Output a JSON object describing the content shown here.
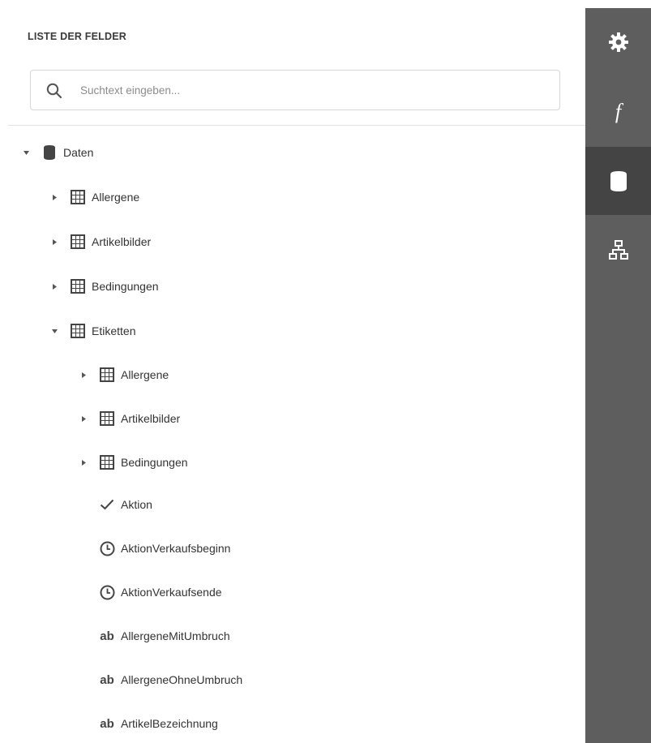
{
  "panel": {
    "title": "LISTE DER FELDER",
    "search": {
      "placeholder": "Suchtext eingeben...",
      "value": ""
    }
  },
  "tree": {
    "root": {
      "label": "Daten",
      "icon": "database-icon",
      "state": "expanded"
    },
    "items": [
      {
        "label": "Allergene",
        "icon": "table-icon",
        "state": "collapsed"
      },
      {
        "label": "Artikelbilder",
        "icon": "table-icon",
        "state": "collapsed"
      },
      {
        "label": "Bedingungen",
        "icon": "table-icon",
        "state": "collapsed"
      },
      {
        "label": "Etiketten",
        "icon": "table-icon",
        "state": "expanded",
        "children": [
          {
            "label": "Allergene",
            "icon": "table-icon",
            "state": "collapsed"
          },
          {
            "label": "Artikelbilder",
            "icon": "table-icon",
            "state": "collapsed"
          },
          {
            "label": "Bedingungen",
            "icon": "table-icon",
            "state": "collapsed"
          },
          {
            "label": "Aktion",
            "icon": "checkmark-icon"
          },
          {
            "label": "AktionVerkaufsbeginn",
            "icon": "clock-icon"
          },
          {
            "label": "AktionVerkaufsende",
            "icon": "clock-icon"
          },
          {
            "label": "AllergeneMitUmbruch",
            "icon": "text-ab-icon",
            "glyph": "ab"
          },
          {
            "label": "AllergeneOhneUmbruch",
            "icon": "text-ab-icon",
            "glyph": "ab"
          },
          {
            "label": "ArtikelBezeichnung",
            "icon": "text-ab-icon",
            "glyph": "ab"
          }
        ]
      }
    ]
  },
  "sidebar": {
    "buttons": [
      {
        "name": "properties",
        "icon": "gear-icon",
        "active": false
      },
      {
        "name": "expressions",
        "icon": "function-icon",
        "glyph": "f",
        "active": false
      },
      {
        "name": "field-list",
        "icon": "database-icon",
        "active": true
      },
      {
        "name": "report-explorer",
        "icon": "hierarchy-icon",
        "active": false
      }
    ]
  },
  "colors": {
    "sidebar_bg": "#5e5e5e",
    "sidebar_active": "#444444",
    "icon_dark": "#444444",
    "text": "#333333",
    "border": "#d6d6d6"
  }
}
